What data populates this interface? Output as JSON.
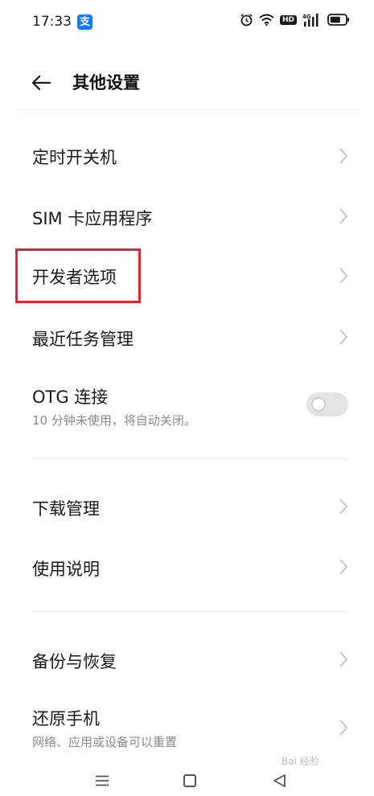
{
  "status_bar": {
    "time": "17:33",
    "app_badge": "支",
    "hd": "HD",
    "network": "4G"
  },
  "header": {
    "title": "其他设置"
  },
  "items": [
    {
      "label": "定时开关机"
    },
    {
      "label": "SIM 卡应用程序"
    },
    {
      "label": "开发者选项"
    },
    {
      "label": "最近任务管理"
    },
    {
      "label": "OTG 连接",
      "subtitle": "10 分钟未使用，将自动关闭。",
      "toggle_on": false
    },
    {
      "label": "下载管理"
    },
    {
      "label": "使用说明"
    },
    {
      "label": "备份与恢复"
    },
    {
      "label": "还原手机",
      "subtitle": "网络、应用或设备可以重置"
    }
  ],
  "watermark": "Bai 经验",
  "colors": {
    "highlight": "#e3232f",
    "alipay": "#1677ff"
  },
  "icons": [
    "back-arrow-icon",
    "chevron-right-icon",
    "alarm-icon",
    "wifi-icon",
    "signal-icon",
    "battery-icon",
    "menu-icon",
    "home-icon",
    "back-triangle-icon"
  ]
}
